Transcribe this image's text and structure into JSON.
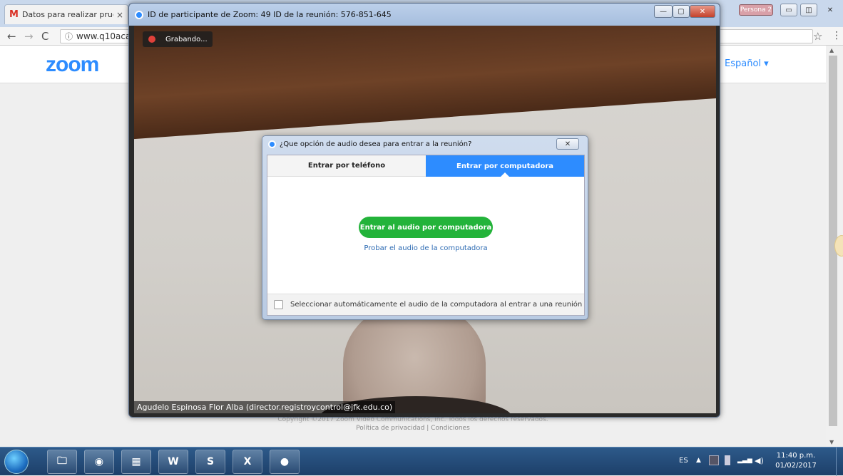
{
  "browser": {
    "tab_title": "Datos para realizar prue",
    "tab_close": "×",
    "url": "www.q10acad",
    "persona": "Persona 2",
    "lang_selector": "Español ▾"
  },
  "page": {
    "logo": "zoom",
    "copyright": "Copyright ©2017 Zoom Video Communications, Inc. Todos los derechos reservados.",
    "policy": "Política de privacidad | Condiciones"
  },
  "zoom_window": {
    "title": "ID de participante de Zoom: 49   ID de la reunión: 576-851-645",
    "recording": "Grabando...",
    "participant": "Agudelo Espinosa Flor Alba (director.registroycontrol@jfk.edu.co)"
  },
  "dialog": {
    "title": "¿Que opción de audio desea para entrar a la reunión?",
    "tab_phone": "Entrar por teléfono",
    "tab_computer": "Entrar por computadora",
    "join_button": "Entrar al audio por computadora",
    "test_link": "Probar el audio de la computadora",
    "auto_select": "Seleccionar automáticamente el audio de la computadora al entrar a una reunión"
  },
  "taskbar": {
    "apps": [
      "explorer",
      "chrome",
      "chart",
      "word",
      "skype",
      "excel",
      "zoom"
    ],
    "lang": "ES",
    "time": "11:40 p.m.",
    "date": "01/02/2017"
  },
  "colors": {
    "zoom_blue": "#2d8cff",
    "join_green": "#23b33a"
  }
}
